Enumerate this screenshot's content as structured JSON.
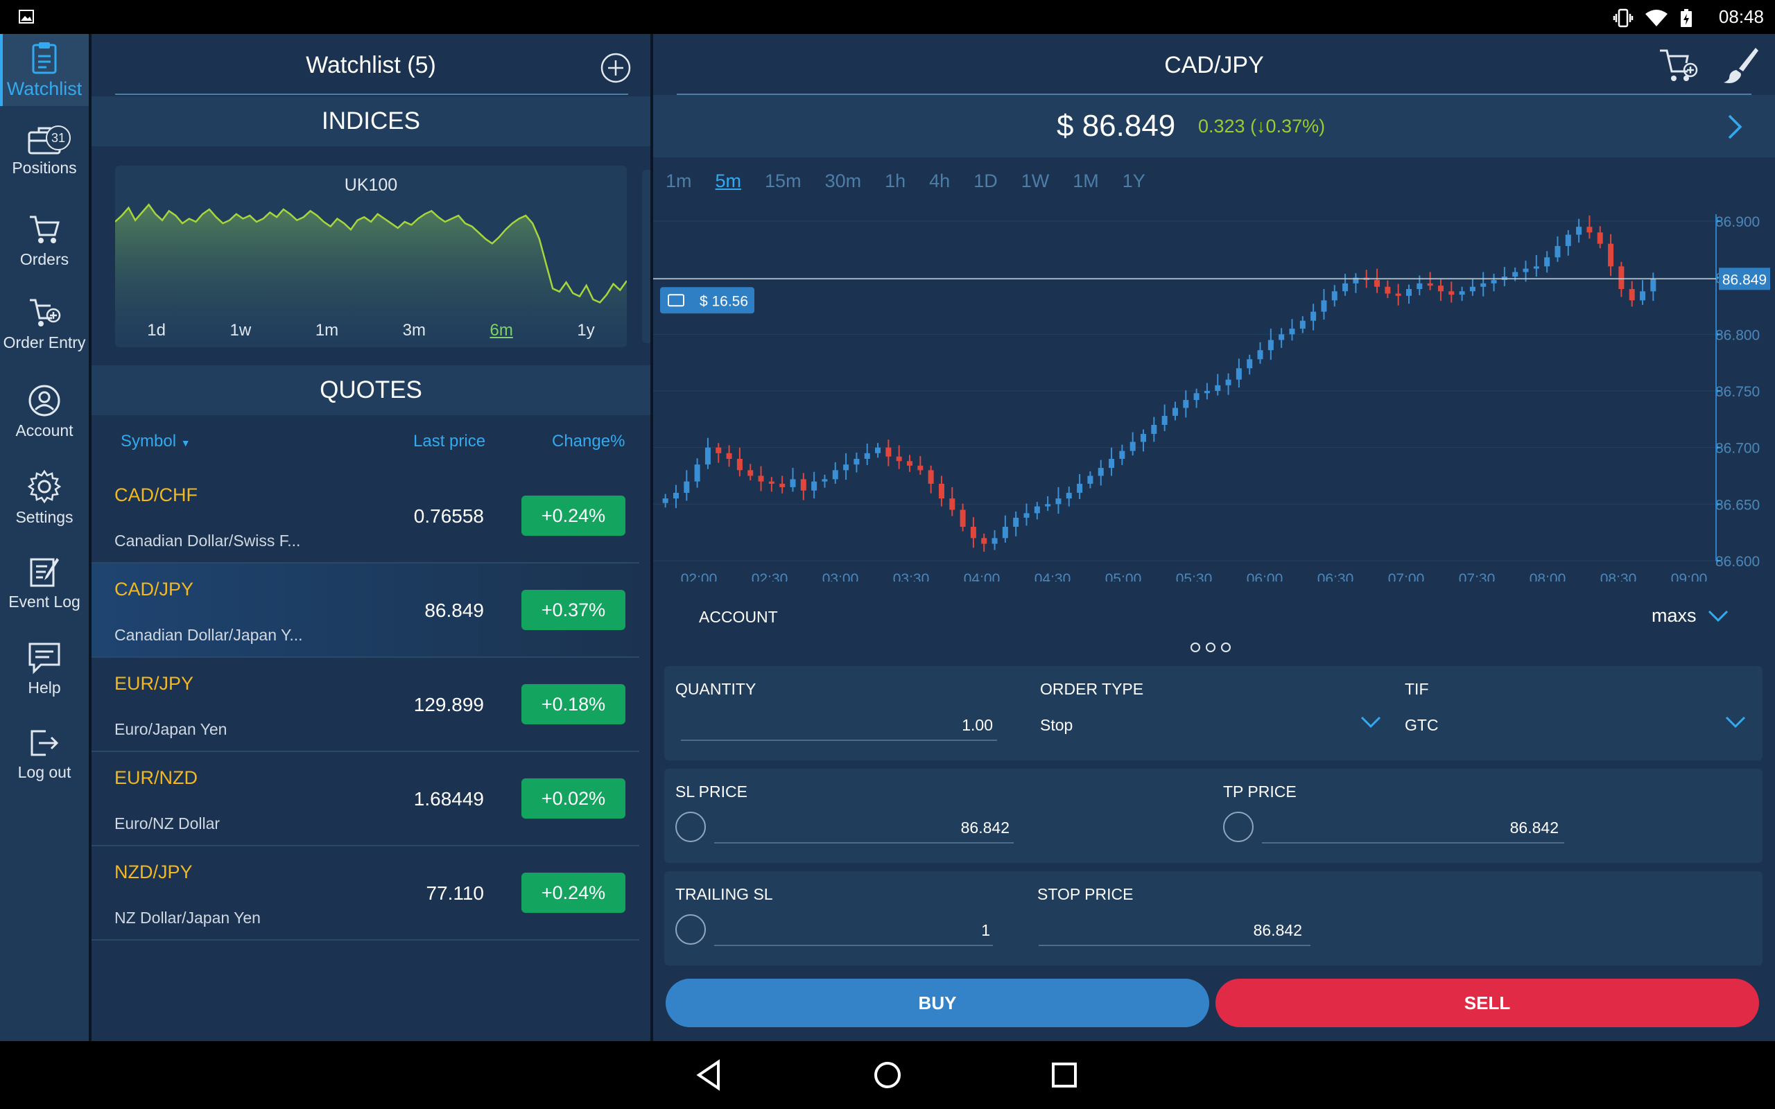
{
  "status_bar": {
    "time": "08:48",
    "icons": [
      "image-icon",
      "vibrate-icon",
      "wifi-icon",
      "battery-icon"
    ]
  },
  "sidebar": {
    "items": [
      {
        "label": "Watchlist",
        "icon": "clipboard-icon",
        "active": true
      },
      {
        "label": "Positions",
        "icon": "briefcase-icon",
        "badge": "31"
      },
      {
        "label": "Orders",
        "icon": "cart-icon"
      },
      {
        "label": "Order Entry",
        "icon": "cart-plus-icon"
      },
      {
        "label": "Account",
        "icon": "user-icon"
      },
      {
        "label": "Settings",
        "icon": "gear-icon"
      },
      {
        "label": "Event Log",
        "icon": "notepad-icon"
      },
      {
        "label": "Help",
        "icon": "chat-icon"
      },
      {
        "label": "Log out",
        "icon": "logout-icon"
      }
    ]
  },
  "watchlist": {
    "title": "Watchlist (5)",
    "indices_header": "INDICES",
    "index_card": {
      "name": "UK100",
      "ranges": [
        "1d",
        "1w",
        "1m",
        "3m",
        "6m",
        "1y"
      ],
      "active_range": "6m",
      "sparkline": [
        71,
        75,
        80,
        72,
        77,
        82,
        76,
        72,
        78,
        75,
        70,
        73,
        71,
        76,
        79,
        74,
        70,
        72,
        76,
        73,
        75,
        71,
        73,
        77,
        74,
        79,
        76,
        72,
        74,
        78,
        75,
        71,
        68,
        73,
        70,
        66,
        72,
        74,
        71,
        76,
        73,
        70,
        67,
        71,
        69,
        73,
        76,
        78,
        74,
        71,
        73,
        75,
        70,
        68,
        64,
        60,
        57,
        61,
        66,
        70,
        73,
        75,
        70,
        60,
        44,
        28,
        26,
        32,
        25,
        23,
        30,
        21,
        19,
        24,
        31,
        27,
        33
      ]
    },
    "quotes_header": "QUOTES",
    "columns": {
      "symbol": "Symbol",
      "last": "Last price",
      "change": "Change%"
    },
    "quotes": [
      {
        "symbol": "CAD/CHF",
        "name": "Canadian Dollar/Swiss F...",
        "price": "0.76558",
        "change": "+0.24%"
      },
      {
        "symbol": "CAD/JPY",
        "name": "Canadian Dollar/Japan Y...",
        "price": "86.849",
        "change": "+0.37%",
        "selected": true
      },
      {
        "symbol": "EUR/JPY",
        "name": "Euro/Japan Yen",
        "price": "129.899",
        "change": "+0.18%"
      },
      {
        "symbol": "EUR/NZD",
        "name": "Euro/NZ Dollar",
        "price": "1.68449",
        "change": "+0.02%"
      },
      {
        "symbol": "NZD/JPY",
        "name": "NZ Dollar/Japan Yen",
        "price": "77.110",
        "change": "+0.24%"
      }
    ]
  },
  "instrument": {
    "title": "CAD/JPY",
    "price": "$ 86.849",
    "change": "0.323 (↓0.37%)",
    "timeframes": [
      "1m",
      "5m",
      "15m",
      "30m",
      "1h",
      "4h",
      "1D",
      "1W",
      "1M",
      "1Y"
    ],
    "active_timeframe": "5m",
    "position_tag": "$ 16.56"
  },
  "chart_data": {
    "type": "candlestick",
    "x_labels": [
      "02:00",
      "02:30",
      "03:00",
      "03:30",
      "04:00",
      "04:30",
      "05:00",
      "05:30",
      "06:00",
      "06:30",
      "07:00",
      "07:30",
      "08:00",
      "08:30",
      "09:00"
    ],
    "y_ticks": [
      "86.900",
      "86.850",
      "86.800",
      "86.750",
      "86.700",
      "86.650",
      "86.600"
    ],
    "ylim": [
      86.6,
      86.9
    ],
    "current_price": "86.849",
    "close_path": [
      86.655,
      86.66,
      86.67,
      86.685,
      86.7,
      86.695,
      86.69,
      86.68,
      86.675,
      86.67,
      86.668,
      86.665,
      86.672,
      86.662,
      86.67,
      86.672,
      86.68,
      86.685,
      86.69,
      86.695,
      86.7,
      86.692,
      86.688,
      86.684,
      86.68,
      86.668,
      86.655,
      86.645,
      86.63,
      86.62,
      86.615,
      86.62,
      86.63,
      86.638,
      86.642,
      86.648,
      86.65,
      86.655,
      86.66,
      86.668,
      86.675,
      86.682,
      86.69,
      86.697,
      86.705,
      86.712,
      86.72,
      86.728,
      86.735,
      86.742,
      86.748,
      86.75,
      86.755,
      86.76,
      86.77,
      86.778,
      86.786,
      86.795,
      86.8,
      86.805,
      86.812,
      86.82,
      86.83,
      86.838,
      86.845,
      86.85,
      86.848,
      86.842,
      86.836,
      86.834,
      86.84,
      86.845,
      86.843,
      86.838,
      86.835,
      86.838,
      86.842,
      86.845,
      86.848,
      86.851,
      86.855,
      86.858,
      86.86,
      86.868,
      86.878,
      86.888,
      86.895,
      86.89,
      86.88,
      86.86,
      86.84,
      86.83,
      86.838,
      86.849
    ]
  },
  "order": {
    "account_label": "ACCOUNT",
    "account_value": "maxs",
    "quantity_label": "QUANTITY",
    "quantity": "1.00",
    "order_type_label": "ORDER TYPE",
    "order_type": "Stop",
    "tif_label": "TIF",
    "tif": "GTC",
    "sl_label": "SL PRICE",
    "sl_value": "86.842",
    "tp_label": "TP PRICE",
    "tp_value": "86.842",
    "trailing_label": "TRAILING SL",
    "trailing_value": "1",
    "stop_label": "STOP PRICE",
    "stop_value": "86.842",
    "buy": "BUY",
    "sell": "SELL"
  },
  "colors": {
    "accent": "#33aaf0",
    "up": "#3b8fd4",
    "down": "#e0463c",
    "positive": "#13a45f",
    "sell": "#e12a46",
    "buy": "#3483c9",
    "symbol": "#f3b820"
  }
}
